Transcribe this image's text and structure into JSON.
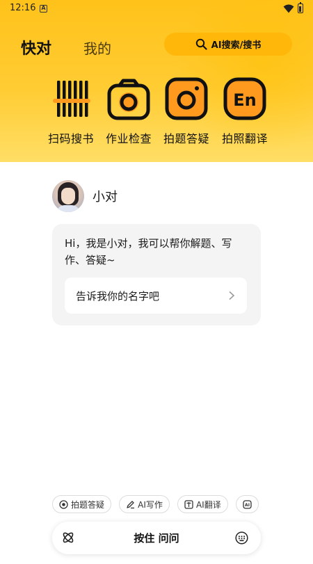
{
  "status_bar": {
    "time": "12:16",
    "notification_glyph": "A"
  },
  "header": {
    "tabs": [
      {
        "label": "快对",
        "active": true
      },
      {
        "label": "我的",
        "active": false
      }
    ],
    "search": {
      "label": "AI搜索/搜书",
      "icon": "search-icon"
    }
  },
  "tools": [
    {
      "label": "扫码搜书",
      "icon": "barcode-icon"
    },
    {
      "label": "作业检查",
      "icon": "camera-check-icon"
    },
    {
      "label": "拍题答疑",
      "icon": "camera-icon"
    },
    {
      "label": "拍照翻译",
      "icon": "translate-icon",
      "icon_text": "En"
    }
  ],
  "bot": {
    "name": "小对",
    "greeting": "Hi，我是小对，我可以帮你解题、写作、答疑~",
    "suggestion": "告诉我你的名字吧"
  },
  "chips": [
    {
      "label": "拍题答疑",
      "icon": "camera-icon"
    },
    {
      "label": "AI写作",
      "icon": "pen-icon"
    },
    {
      "label": "AI翻译",
      "icon": "translate-icon"
    },
    {
      "label": "",
      "icon": "ai-icon",
      "icon_text": "AI"
    }
  ],
  "input_bar": {
    "label": "按住 问问",
    "left_icon": "atom-icon",
    "right_icon": "keyboard-icon"
  },
  "colors": {
    "brand_yellow": "#ffc21a",
    "pill_yellow": "#ffb70a",
    "icon_orange": "#ff9a1f",
    "card_gray": "#f4f4f4"
  }
}
